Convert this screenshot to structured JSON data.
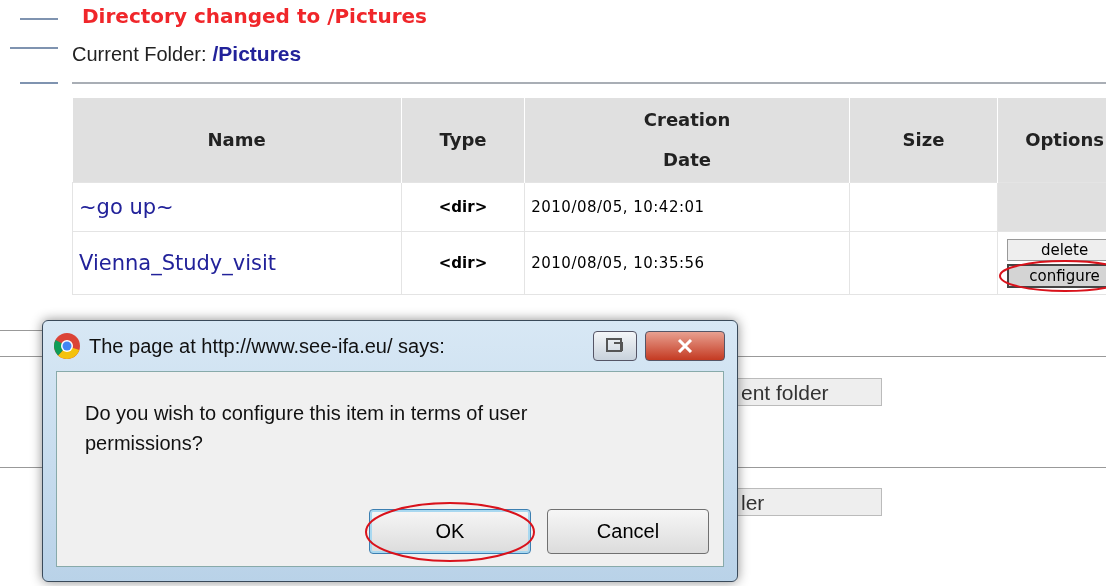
{
  "page": {
    "heading": "Directory changed to /Pictures",
    "current_folder": {
      "label": "Current Folder:",
      "value": "/Pictures"
    }
  },
  "table": {
    "columns": [
      "Name",
      "Type",
      "Creation Date",
      "Size",
      "Options"
    ],
    "rows": [
      {
        "name": "~go up~",
        "type": "<dir>",
        "creation_date": "2010/08/05, 10:42:01",
        "options": []
      },
      {
        "name": "Vienna_Study_visit",
        "type": "<dir>",
        "creation_date": "2010/08/05, 10:35:56",
        "options": [
          {
            "label": "delete",
            "highlighted": false
          },
          {
            "label": "configure",
            "highlighted": true
          }
        ]
      }
    ]
  },
  "background_buttons": [
    "ent folder",
    "ler"
  ],
  "dialog": {
    "title": "The page at http://www.see-ifa.eu/ says:",
    "message": "Do you wish to configure this item in terms of user permissions?",
    "buttons": [
      {
        "label": "OK",
        "focused": true,
        "highlighted": true
      },
      {
        "label": "Cancel",
        "focused": false,
        "highlighted": false
      }
    ]
  }
}
